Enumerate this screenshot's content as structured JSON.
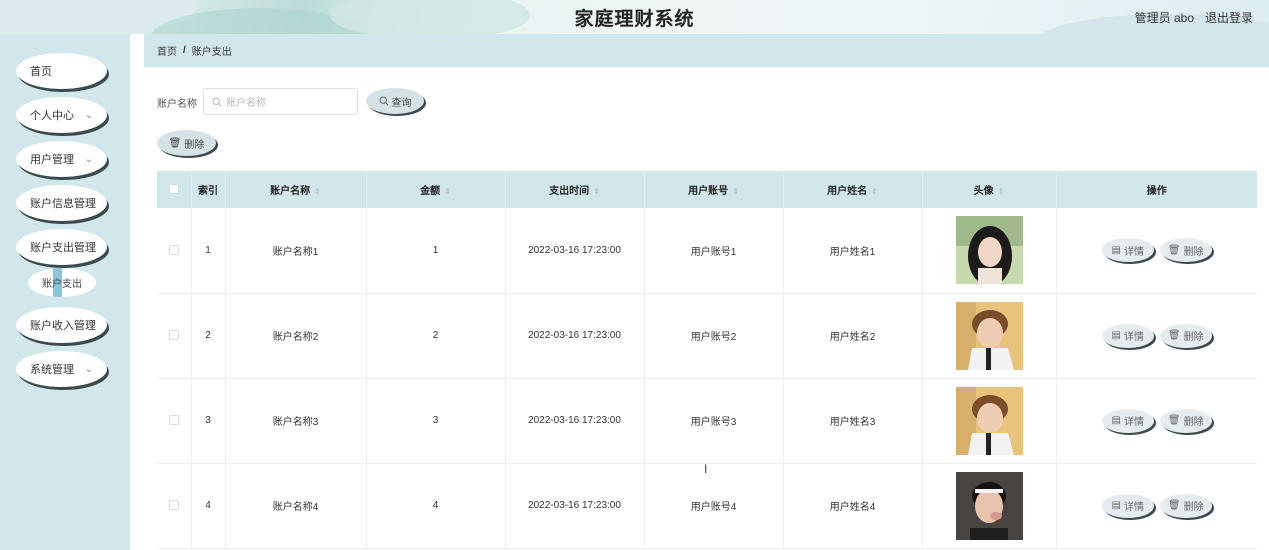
{
  "header": {
    "title": "家庭理财系统",
    "user_label": "管理员 abo",
    "logout_label": "退出登录"
  },
  "sidebar": {
    "items": [
      {
        "label": "首页",
        "has_chevron": false
      },
      {
        "label": "个人中心",
        "has_chevron": true
      },
      {
        "label": "用户管理",
        "has_chevron": true
      },
      {
        "label": "账户信息管理",
        "has_chevron": false
      },
      {
        "label": "账户支出管理",
        "has_chevron": false
      },
      {
        "label": "账户收入管理",
        "has_chevron": false
      },
      {
        "label": "系统管理",
        "has_chevron": true
      }
    ],
    "sub_item": {
      "label": "账户支出"
    }
  },
  "breadcrumb": {
    "home": "首页",
    "separator": "/",
    "current": "账户支出"
  },
  "search": {
    "label": "账户名称",
    "placeholder": "账户名称",
    "query_button": "查询",
    "delete_button": "删除"
  },
  "table": {
    "columns": [
      "索引",
      "账户名称",
      "金额",
      "支出时间",
      "用户账号",
      "用户姓名",
      "头像",
      "操作"
    ],
    "sortable": [
      false,
      true,
      true,
      true,
      true,
      true,
      true,
      false
    ],
    "rows": [
      {
        "index": "1",
        "account_name": "账户名称1",
        "amount": "1",
        "time": "2022-03-16 17:23:00",
        "user_account": "用户账号1",
        "user_name": "用户姓名1",
        "avatar": "avatar-woman"
      },
      {
        "index": "2",
        "account_name": "账户名称2",
        "amount": "2",
        "time": "2022-03-16 17:23:00",
        "user_account": "用户账号2",
        "user_name": "用户姓名2",
        "avatar": "avatar-man"
      },
      {
        "index": "3",
        "account_name": "账户名称3",
        "amount": "3",
        "time": "2022-03-16 17:23:00",
        "user_account": "用户账号3",
        "user_name": "用户姓名3",
        "avatar": "avatar-man"
      },
      {
        "index": "4",
        "account_name": "账户名称4",
        "amount": "4",
        "time": "2022-03-16 17:23:00",
        "user_account": "用户账号4",
        "user_name": "用户姓名4",
        "avatar": "avatar-boy"
      }
    ],
    "action_detail": "详情",
    "action_delete": "删除"
  }
}
